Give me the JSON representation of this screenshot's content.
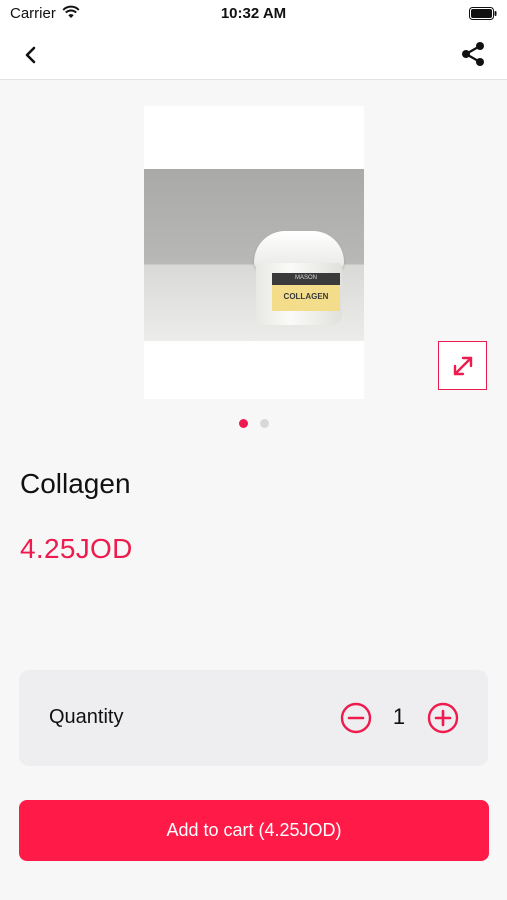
{
  "status_bar": {
    "carrier": "Carrier",
    "time": "10:32 AM"
  },
  "nav": {
    "back_icon": "chevron-left-icon",
    "share_icon": "share-icon"
  },
  "product": {
    "image_label": "COLLAGEN",
    "image_brand": "MASON",
    "title": "Collagen",
    "price": "4.25JOD",
    "image_count": 2,
    "active_image_index": 0
  },
  "quantity": {
    "label": "Quantity",
    "value": "1",
    "decrement_icon": "minus-circle-icon",
    "increment_icon": "plus-circle-icon"
  },
  "cart": {
    "button_label": "Add to cart (4.25JOD)"
  },
  "colors": {
    "accent": "#ee1c4e",
    "button": "#ff1a48",
    "panel": "#eeeef0",
    "background": "#f7f7f7"
  }
}
